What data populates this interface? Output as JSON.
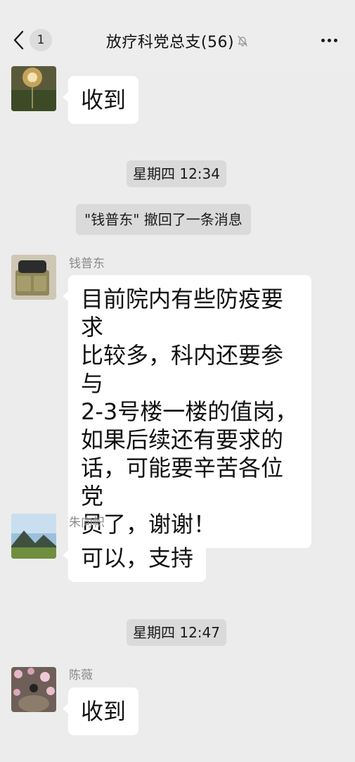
{
  "header": {
    "back_count": "1",
    "title": "放疗科党总支(56)"
  },
  "messages": [
    {
      "sender": "",
      "text": "收到"
    },
    {
      "time": "星期四 12:34"
    },
    {
      "system": "\"钱普东\" 撤回了一条消息"
    },
    {
      "sender": "钱普东",
      "text": "目前院内有些防疫要求比较多，科内还要参与2-3号楼一楼的值岗，如果后续还有要求的话，可能要辛苦各位党员了，谢谢！"
    },
    {
      "sender": "朱向帜",
      "text": "可以，支持"
    },
    {
      "time": "星期四 12:47"
    },
    {
      "sender": "陈薇",
      "text": "收到"
    }
  ],
  "bubble_lines": {
    "m4": [
      "目前院内有些防疫要求",
      "比较多，科内还要参与",
      "2-3号楼一楼的值岗，",
      "如果后续还有要求的",
      "话，可能要辛苦各位党",
      "员了，谢谢！"
    ]
  },
  "icons": {
    "back": "chevron-left-icon",
    "mute": "bell-slash-icon",
    "more": "ellipsis-icon"
  },
  "colors": {
    "background": "#ededed",
    "bubble": "#ffffff",
    "pill": "#dadada",
    "sender_name": "#8a8a8a"
  }
}
